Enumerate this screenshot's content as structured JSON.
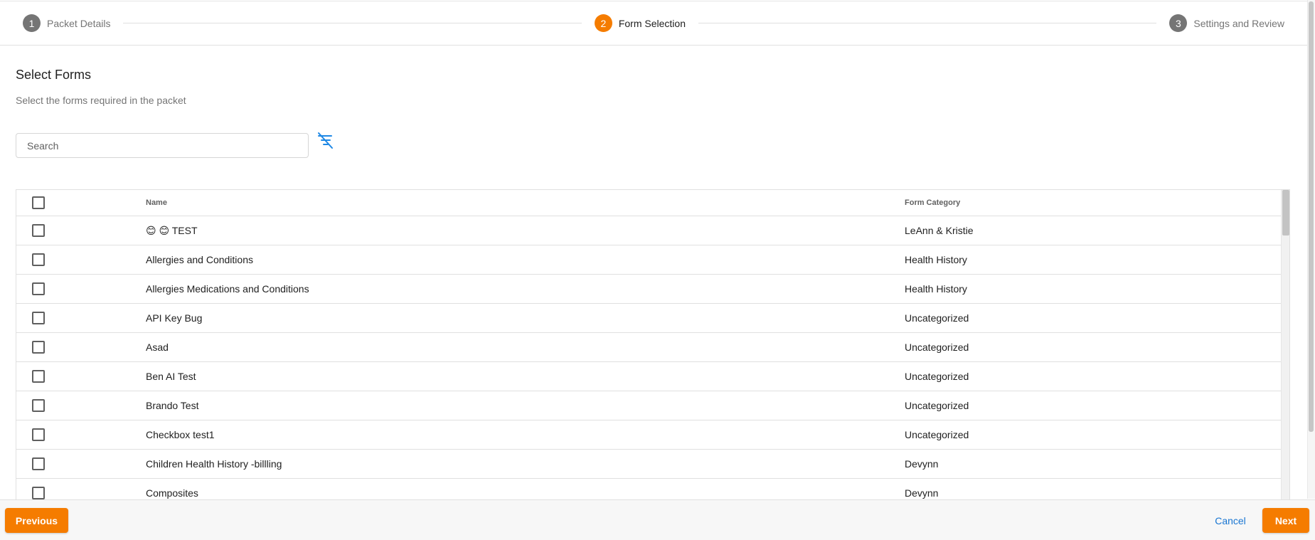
{
  "stepper": {
    "steps": [
      {
        "number": "1",
        "label": "Packet Details",
        "state": "inactive"
      },
      {
        "number": "2",
        "label": "Form Selection",
        "state": "active"
      },
      {
        "number": "3",
        "label": "Settings and Review",
        "state": "inactive"
      }
    ]
  },
  "section": {
    "title": "Select Forms",
    "subtitle": "Select the forms required in the packet"
  },
  "search": {
    "placeholder": "Search",
    "value": ""
  },
  "filter_clear_icon": "filter-off-icon",
  "table": {
    "columns": {
      "name": "Name",
      "category": "Form Category"
    },
    "rows": [
      {
        "name": "😊 😊 TEST",
        "category": "LeAnn & Kristie",
        "checked": false
      },
      {
        "name": "Allergies and Conditions",
        "category": "Health History",
        "checked": false
      },
      {
        "name": "Allergies Medications and Conditions",
        "category": "Health History",
        "checked": false
      },
      {
        "name": "API Key Bug",
        "category": "Uncategorized",
        "checked": false
      },
      {
        "name": "Asad",
        "category": "Uncategorized",
        "checked": false
      },
      {
        "name": "Ben AI Test",
        "category": "Uncategorized",
        "checked": false
      },
      {
        "name": "Brando Test",
        "category": "Uncategorized",
        "checked": false
      },
      {
        "name": "Checkbox test1",
        "category": "Uncategorized",
        "checked": false
      },
      {
        "name": "Children Health History -billling",
        "category": "Devynn",
        "checked": false
      },
      {
        "name": "Composites",
        "category": "Devynn",
        "checked": false
      }
    ]
  },
  "footer": {
    "previous_label": "Previous",
    "cancel_label": "Cancel",
    "next_label": "Next"
  },
  "colors": {
    "accent": "#f57c00",
    "link": "#1976d2",
    "step_inactive": "#757575"
  }
}
